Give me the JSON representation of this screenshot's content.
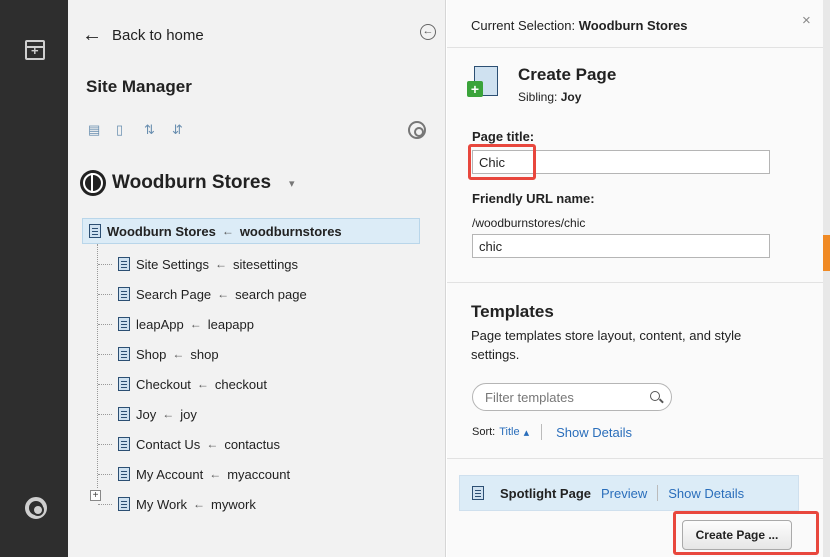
{
  "site_manager": {
    "back_label": "Back to home",
    "title": "Site Manager",
    "site_name": "Woodburn Stores",
    "tree": {
      "root": {
        "name": "Woodburn Stores",
        "url": "woodburnstores"
      },
      "children": [
        {
          "name": "Site Settings",
          "url": "sitesettings"
        },
        {
          "name": "Search Page",
          "url": "search page"
        },
        {
          "name": "leapApp",
          "url": "leapapp"
        },
        {
          "name": "Shop",
          "url": "shop"
        },
        {
          "name": "Checkout",
          "url": "checkout"
        },
        {
          "name": "Joy",
          "url": "joy"
        },
        {
          "name": "Contact Us",
          "url": "contactus"
        },
        {
          "name": "My Account",
          "url": "myaccount"
        },
        {
          "name": "My Work",
          "url": "mywork"
        }
      ],
      "arrow": "←"
    }
  },
  "create_page": {
    "current_selection_label": "Current Selection:",
    "current_selection_value": "Woodburn Stores",
    "title": "Create Page",
    "sibling_label": "Sibling:",
    "sibling_value": "Joy",
    "page_title_label": "Page title:",
    "page_title_value": "Chic",
    "friendly_url_label": "Friendly URL name:",
    "friendly_url_prefix": "/woodburnstores/chic",
    "friendly_url_value": "chic",
    "templates_title": "Templates",
    "templates_desc": "Page templates store layout, content, and style settings.",
    "filter_placeholder": "Filter templates",
    "sort_label": "Sort:",
    "sort_value": "Title",
    "show_details": "Show Details",
    "template_name": "Spotlight Page",
    "preview_label": "Preview",
    "create_button": "Create Page ..."
  },
  "colors": {
    "highlight": "#e8473d",
    "selection": "#dcecf7",
    "link": "#2a6ebb"
  }
}
